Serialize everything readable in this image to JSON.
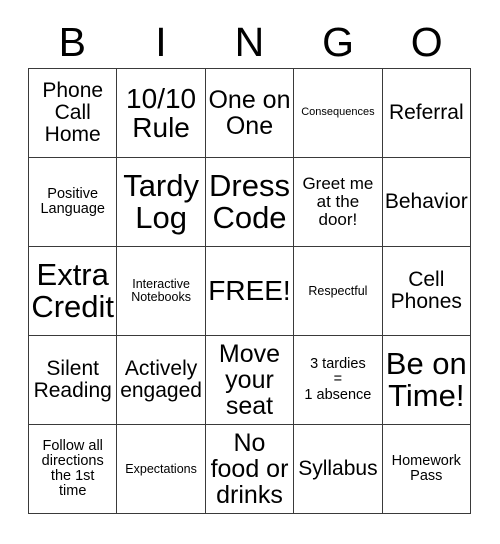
{
  "card": {
    "title": "BINGO",
    "header_letters": [
      "B",
      "I",
      "N",
      "G",
      "O"
    ],
    "free_space_label": "FREE!",
    "colors": {
      "text": "#000000",
      "border": "#3a3a3a",
      "background": "#ffffff"
    },
    "grid": {
      "rows": 5,
      "columns": 5,
      "cells": [
        {
          "text": "Phone\nCall\nHome",
          "size": "md",
          "lines": 3
        },
        {
          "text": "10/10\nRule",
          "size": "xl",
          "lines": 2
        },
        {
          "text": "One on\nOne",
          "size": "lg",
          "lines": 2
        },
        {
          "text": "Consequences",
          "size": "tiny",
          "lines": 1
        },
        {
          "text": "Referral",
          "size": "md",
          "lines": 1
        },
        {
          "text": "Positive\nLanguage",
          "size": "xs",
          "lines": 2
        },
        {
          "text": "Tardy\nLog",
          "size": "xxl",
          "lines": 2
        },
        {
          "text": "Dress\nCode",
          "size": "xxl",
          "lines": 2
        },
        {
          "text": "Greet me\nat the\ndoor!",
          "size": "sm",
          "lines": 3
        },
        {
          "text": "Behavior",
          "size": "md",
          "lines": 1
        },
        {
          "text": "Extra\nCredit",
          "size": "xxl",
          "lines": 2
        },
        {
          "text": "Interactive\nNotebooks",
          "size": "xxs",
          "lines": 2
        },
        {
          "text": "FREE!",
          "size": "xl",
          "lines": 1
        },
        {
          "text": "Respectful",
          "size": "xxs",
          "lines": 1
        },
        {
          "text": "Cell\nPhones",
          "size": "md",
          "lines": 2
        },
        {
          "text": "Silent\nReading",
          "size": "md",
          "lines": 2
        },
        {
          "text": "Actively\nengaged",
          "size": "md",
          "lines": 2
        },
        {
          "text": "Move\nyour\nseat",
          "size": "lg",
          "lines": 3
        },
        {
          "text": "3 tardies\n=\n1 absence",
          "size": "xs",
          "lines": 3
        },
        {
          "text": "Be on\nTime!",
          "size": "xxl",
          "lines": 2
        },
        {
          "text": "Follow all\ndirections\nthe 1st\ntime",
          "size": "xs",
          "lines": 4
        },
        {
          "text": "Expectations",
          "size": "xxs",
          "lines": 1
        },
        {
          "text": "No\nfood or\ndrinks",
          "size": "lg",
          "lines": 3
        },
        {
          "text": "Syllabus",
          "size": "md",
          "lines": 1
        },
        {
          "text": "Homework\nPass",
          "size": "xs",
          "lines": 2
        }
      ]
    }
  }
}
